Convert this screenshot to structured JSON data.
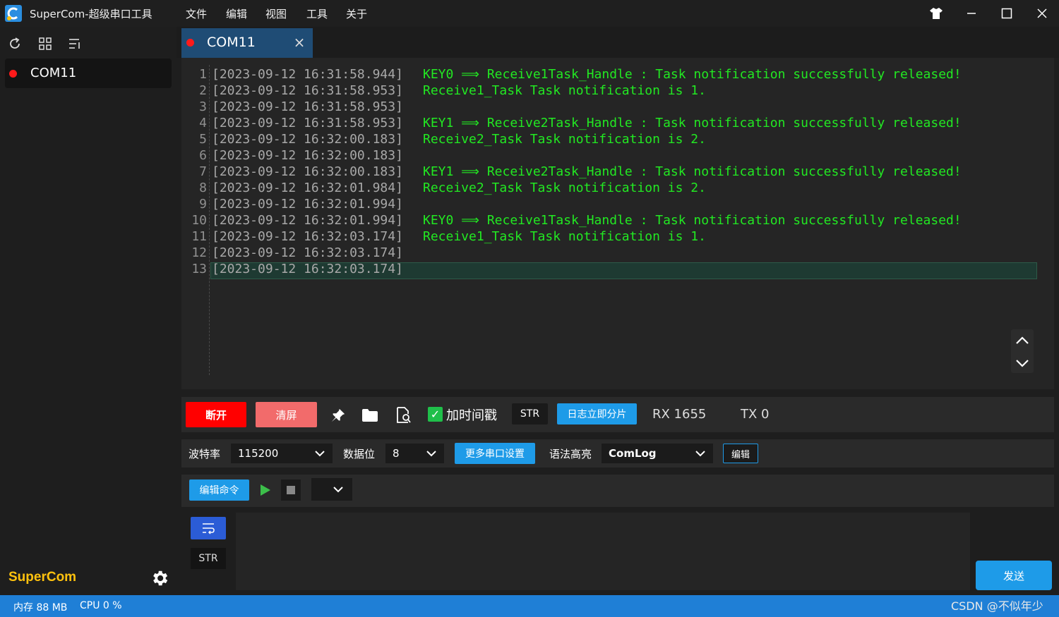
{
  "app": {
    "title": "SuperCom-超级串口工具",
    "brand": "SuperCom"
  },
  "menu": [
    "文件",
    "编辑",
    "视图",
    "工具",
    "关于"
  ],
  "sidebar": {
    "items": [
      {
        "label": "COM11",
        "status_color": "#ff1a1a"
      }
    ]
  },
  "tab": {
    "label": "COM11",
    "close": "×"
  },
  "log": {
    "lines": [
      {
        "n": "1",
        "ts": "[2023-09-12 16:31:58.944]",
        "msg": "KEY0 ⟹ Receive1Task_Handle : Task notification successfully released!"
      },
      {
        "n": "2",
        "ts": "[2023-09-12 16:31:58.953]",
        "msg": "Receive1_Task Task notification is 1."
      },
      {
        "n": "3",
        "ts": "[2023-09-12 16:31:58.953]",
        "msg": ""
      },
      {
        "n": "4",
        "ts": "[2023-09-12 16:31:58.953]",
        "msg": "KEY1 ⟹ Receive2Task_Handle : Task notification successfully released!"
      },
      {
        "n": "5",
        "ts": "[2023-09-12 16:32:00.183]",
        "msg": "Receive2_Task Task notification is 2."
      },
      {
        "n": "6",
        "ts": "[2023-09-12 16:32:00.183]",
        "msg": ""
      },
      {
        "n": "7",
        "ts": "[2023-09-12 16:32:00.183]",
        "msg": "KEY1 ⟹ Receive2Task_Handle : Task notification successfully released!"
      },
      {
        "n": "8",
        "ts": "[2023-09-12 16:32:01.984]",
        "msg": "Receive2_Task Task notification is 2."
      },
      {
        "n": "9",
        "ts": "[2023-09-12 16:32:01.994]",
        "msg": ""
      },
      {
        "n": "10",
        "ts": "[2023-09-12 16:32:01.994]",
        "msg": "KEY0 ⟹ Receive1Task_Handle : Task notification successfully released!"
      },
      {
        "n": "11",
        "ts": "[2023-09-12 16:32:03.174]",
        "msg": "Receive1_Task Task notification is 1."
      },
      {
        "n": "12",
        "ts": "[2023-09-12 16:32:03.174]",
        "msg": ""
      },
      {
        "n": "13",
        "ts": "[2023-09-12 16:32:03.174]",
        "msg": ""
      }
    ]
  },
  "toolbar": {
    "disconnect": "断开",
    "clear": "清屏",
    "timestamp_label": "加时间戳",
    "timestamp_checked": true,
    "str": "STR",
    "split_log": "日志立即分片",
    "rx": "RX 1655",
    "tx": "TX 0"
  },
  "settings": {
    "baud_label": "波特率",
    "baud_value": "115200",
    "databits_label": "数据位",
    "databits_value": "8",
    "more_button": "更多串口设置",
    "syntax_label": "语法高亮",
    "syntax_value": "ComLog",
    "edit_button": "编辑"
  },
  "command": {
    "edit_button": "编辑命令",
    "select_value": ""
  },
  "send": {
    "str": "STR",
    "input_value": "",
    "button": "发送"
  },
  "status": {
    "memory": "内存 88 MB",
    "cpu": "CPU 0 %"
  },
  "watermark": "CSDN @不似年少",
  "colors": {
    "accent": "#1e9be8",
    "danger": "#ff0000",
    "log_text": "#22e822",
    "status_bar": "#1f7fd6",
    "brand": "#ffc20e"
  }
}
